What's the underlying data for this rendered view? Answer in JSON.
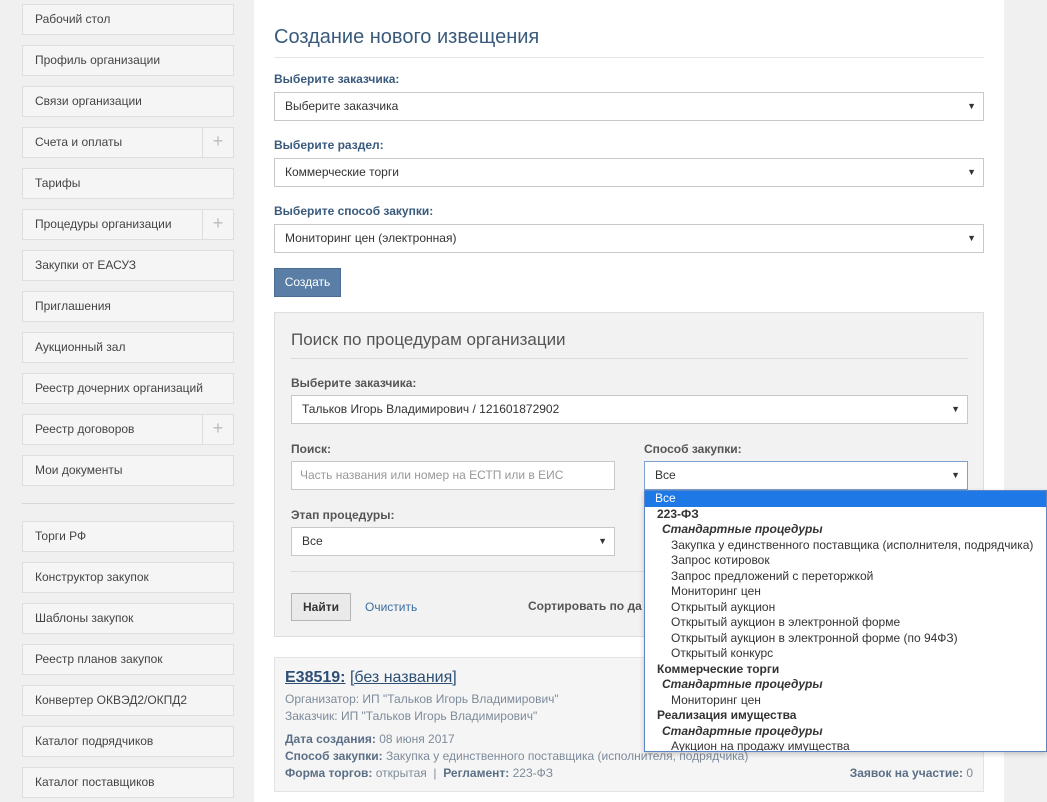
{
  "sidebar": {
    "items": [
      {
        "label": "Рабочий стол"
      },
      {
        "label": "Профиль организации"
      },
      {
        "label": "Связи организации"
      },
      {
        "label": "Счета и оплаты",
        "plus": "+"
      },
      {
        "label": "Тарифы"
      },
      {
        "label": "Процедуры организации",
        "plus": "+"
      },
      {
        "label": "Закупки от ЕАСУЗ"
      },
      {
        "label": "Приглашения"
      },
      {
        "label": "Аукционный зал"
      },
      {
        "label": "Реестр дочерних организаций"
      },
      {
        "label": "Реестр договоров",
        "plus": "+"
      },
      {
        "label": "Мои документы"
      }
    ],
    "items2": [
      {
        "label": "Торги РФ"
      },
      {
        "label": "Конструктор закупок"
      },
      {
        "label": "Шаблоны закупок"
      },
      {
        "label": "Реестр планов закупок"
      },
      {
        "label": "Конвертер ОКВЭД2/ОКПД2"
      },
      {
        "label": "Каталог подрядчиков"
      },
      {
        "label": "Каталог поставщиков"
      }
    ]
  },
  "create": {
    "title": "Создание нового извещения",
    "customer_label": "Выберите заказчика:",
    "customer_value": "Выберите заказчика",
    "section_label": "Выберите раздел:",
    "section_value": "Коммерческие торги",
    "method_label": "Выберите способ закупки:",
    "method_value": "Мониторинг цен (электронная)",
    "create_button": "Создать"
  },
  "search": {
    "title": "Поиск по процедурам организации",
    "customer_label": "Выберите заказчика:",
    "customer_value": "Тальков Игорь Владимирович / 121601872902",
    "query_label": "Поиск:",
    "query_placeholder": "Часть названия или номер на ЕСТП или в ЕИС",
    "method_label": "Способ закупки:",
    "method_value": "Все",
    "stage_label": "Этап процедуры:",
    "stage_value": "Все",
    "find_button": "Найти",
    "clear_link": "Очистить",
    "sort_label": "Сортировать по да"
  },
  "dropdown": {
    "selected": "Все",
    "groups": [
      {
        "name": "223-ФЗ",
        "subgroups": [
          {
            "name": "Стандартные процедуры",
            "options": [
              "Закупка у единственного поставщика (исполнителя, подрядчика)",
              "Запрос котировок",
              "Запрос предложений с переторжкой",
              "Мониторинг цен",
              "Открытый аукцион",
              "Открытый аукцион в электронной форме",
              "Открытый аукцион в электронной форме (по 94ФЗ)",
              "Открытый конкурс"
            ]
          }
        ]
      },
      {
        "name": "Коммерческие торги",
        "subgroups": [
          {
            "name": "Стандартные процедуры",
            "options": [
              "Мониторинг цен"
            ]
          }
        ]
      },
      {
        "name": "Реализация имущества",
        "subgroups": [
          {
            "name": "Стандартные процедуры",
            "options": [
              "Аукцион на продажу имущества"
            ]
          }
        ]
      }
    ]
  },
  "result": {
    "number": "Е38519:",
    "name": "[без названия]",
    "organizer": "Организатор: ИП \"Тальков Игорь Владимирович\"",
    "customer": "Заказчик: ИП \"Тальков Игорь Владимирович\"",
    "created_label": "Дата создания:",
    "created_value": "08 июня 2017",
    "method_label": "Способ закупки:",
    "method_value": "Закупка у единственного поставщика (исполнителя, подрядчика)",
    "form_label": "Форма торгов:",
    "form_value": "открытая",
    "separator": "|",
    "reglament_label": "Регламент:",
    "reglament_value": "223-ФЗ",
    "bids_label": "Заявок на участие:",
    "bids_value": "0"
  },
  "icons": {
    "caret": "▼"
  },
  "colors": {
    "accent": "#5a7ea6",
    "heading": "#3a5a7c",
    "dropdown_selected": "#1e78e6"
  }
}
